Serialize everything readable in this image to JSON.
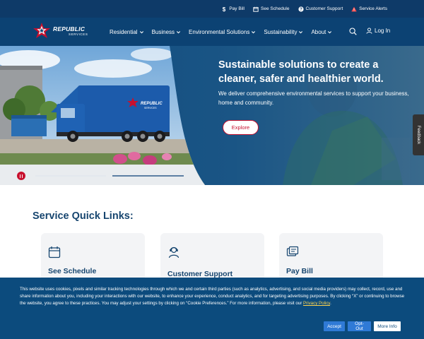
{
  "utility_bar": {
    "items": [
      {
        "label": "Pay Bill",
        "icon": "dollar-icon"
      },
      {
        "label": "See Schedule",
        "icon": "calendar-icon"
      },
      {
        "label": "Customer Support",
        "icon": "question-icon"
      },
      {
        "label": "Service Alerts",
        "icon": "warning-icon"
      }
    ]
  },
  "nav": {
    "logo_word": "REPUBLIC",
    "logo_sub": "SERVICES",
    "items": [
      "Residential",
      "Business",
      "Environmental Solutions",
      "Sustainability",
      "About"
    ],
    "login_label": "Log In",
    "search_icon": "search-icon"
  },
  "hero": {
    "title": "Sustainable solutions to create a cleaner, safer and healthier world.",
    "subtitle": "We deliver comprehensive environmental services to support your business, home and community.",
    "cta_label": "Explore",
    "truck_logo_word": "REPUBLIC",
    "truck_logo_sub": "SERVICES"
  },
  "feedback": {
    "label": "Feedback"
  },
  "quick_links": {
    "title": "Service Quick Links:",
    "cards": [
      {
        "label": "See Schedule",
        "icon": "calendar-icon"
      },
      {
        "label": "Customer Support",
        "icon": "support-agent-icon"
      },
      {
        "label": "Pay Bill",
        "icon": "bill-icon"
      }
    ]
  },
  "cookie": {
    "text": "This website uses cookies, pixels and similar tracking technologies through which we and certain third parties (such as analytics, advertising, and social media providers) may collect, record, use and share information about you, including your interactions with our website, to enhance your experience, conduct analytics, and for targeting advertising purposes. By clicking “X” or continuing to browse the website, you agree to these practices. You may adjust your settings by clicking on “Cookie Preferences.” For more information, please visit our ",
    "link_label": "Privacy Policy",
    "trailing": ".",
    "accept_label": "Accept",
    "optout_label": "Opt-Out",
    "more_label": "More Info"
  },
  "colors": {
    "utility_bg": "#0e3a68",
    "nav_bg": "#0c4273",
    "brand_red": "#c8102e",
    "cookie_bg": "#0c4b7d",
    "heading_blue": "#16456f"
  }
}
